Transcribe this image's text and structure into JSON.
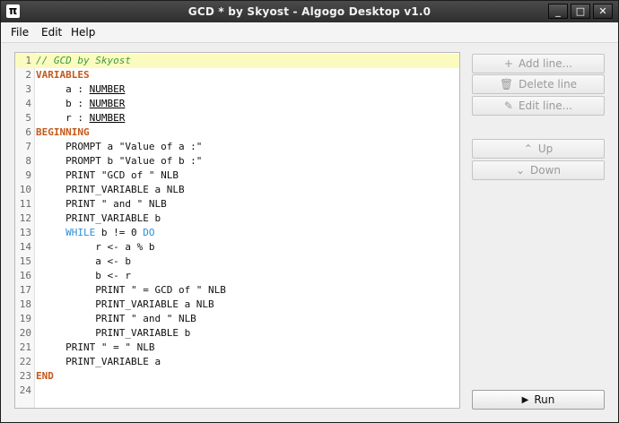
{
  "window": {
    "title": "GCD * by Skyost - Algogo Desktop v1.0",
    "app_icon": "π",
    "controls": {
      "minimize": "_",
      "maximize": "□",
      "close": "✕"
    }
  },
  "menu": [
    "File",
    "Edit",
    "Help"
  ],
  "editor": {
    "lines": [
      {
        "n": "1",
        "parts": [
          {
            "t": "// GCD by Skyost",
            "c": "comment"
          }
        ]
      },
      {
        "n": "2",
        "parts": [
          {
            "t": "VARIABLES",
            "c": "kw-orange"
          }
        ]
      },
      {
        "n": "3",
        "parts": [
          {
            "t": "     a : ",
            "c": "plain"
          },
          {
            "t": "NUMBER",
            "c": "type"
          }
        ]
      },
      {
        "n": "4",
        "parts": [
          {
            "t": "     b : ",
            "c": "plain"
          },
          {
            "t": "NUMBER",
            "c": "type"
          }
        ]
      },
      {
        "n": "5",
        "parts": [
          {
            "t": "     r : ",
            "c": "plain"
          },
          {
            "t": "NUMBER",
            "c": "type"
          }
        ]
      },
      {
        "n": "6",
        "parts": [
          {
            "t": "BEGINNING",
            "c": "kw-orange"
          }
        ]
      },
      {
        "n": "7",
        "parts": [
          {
            "t": "     PROMPT a \"Value of a :\"",
            "c": "plain"
          }
        ]
      },
      {
        "n": "8",
        "parts": [
          {
            "t": "     PROMPT b \"Value of b :\"",
            "c": "plain"
          }
        ]
      },
      {
        "n": "9",
        "parts": [
          {
            "t": "     PRINT \"GCD of \" NLB",
            "c": "plain"
          }
        ]
      },
      {
        "n": "10",
        "parts": [
          {
            "t": "     PRINT_VARIABLE a NLB",
            "c": "plain"
          }
        ]
      },
      {
        "n": "11",
        "parts": [
          {
            "t": "     PRINT \" and \" NLB",
            "c": "plain"
          }
        ]
      },
      {
        "n": "12",
        "parts": [
          {
            "t": "     PRINT_VARIABLE b",
            "c": "plain"
          }
        ]
      },
      {
        "n": "13",
        "parts": [
          {
            "t": "     ",
            "c": "plain"
          },
          {
            "t": "WHILE",
            "c": "kw-blue"
          },
          {
            "t": " b != 0 ",
            "c": "plain"
          },
          {
            "t": "DO",
            "c": "kw-blue"
          }
        ]
      },
      {
        "n": "14",
        "parts": [
          {
            "t": "          r <- a % b",
            "c": "plain"
          }
        ]
      },
      {
        "n": "15",
        "parts": [
          {
            "t": "          a <- b",
            "c": "plain"
          }
        ]
      },
      {
        "n": "16",
        "parts": [
          {
            "t": "          b <- r",
            "c": "plain"
          }
        ]
      },
      {
        "n": "17",
        "parts": [
          {
            "t": "          PRINT \" = GCD of \" NLB",
            "c": "plain"
          }
        ]
      },
      {
        "n": "18",
        "parts": [
          {
            "t": "          PRINT_VARIABLE a NLB",
            "c": "plain"
          }
        ]
      },
      {
        "n": "19",
        "parts": [
          {
            "t": "          PRINT \" and \" NLB",
            "c": "plain"
          }
        ]
      },
      {
        "n": "20",
        "parts": [
          {
            "t": "          PRINT_VARIABLE b",
            "c": "plain"
          }
        ]
      },
      {
        "n": "21",
        "parts": [
          {
            "t": "     PRINT \" = \" NLB",
            "c": "plain"
          }
        ]
      },
      {
        "n": "22",
        "parts": [
          {
            "t": "     PRINT_VARIABLE a",
            "c": "plain"
          }
        ]
      },
      {
        "n": "23",
        "parts": [
          {
            "t": "END",
            "c": "kw-orange"
          }
        ]
      },
      {
        "n": "24",
        "parts": []
      }
    ]
  },
  "buttons": {
    "add_line": {
      "label": "Add line...",
      "icon": "plus-icon",
      "glyph": "+"
    },
    "delete_line": {
      "label": "Delete line",
      "icon": "trash-icon",
      "glyph": "🗑"
    },
    "edit_line": {
      "label": "Edit line...",
      "icon": "pencil-icon",
      "glyph": "✎"
    },
    "up": {
      "label": "Up",
      "icon": "chevron-up-icon",
      "glyph": "⌃"
    },
    "down": {
      "label": "Down",
      "icon": "chevron-down-icon",
      "glyph": "⌄"
    },
    "run": {
      "label": "Run",
      "icon": "play-icon",
      "glyph": "▶"
    }
  }
}
